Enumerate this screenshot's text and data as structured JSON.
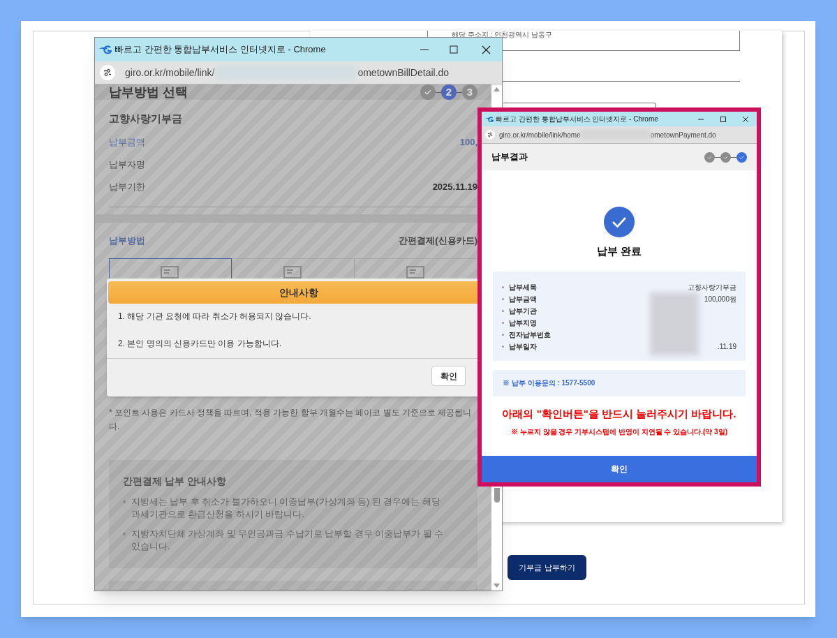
{
  "background_page": {
    "address_text": "해당 주소지 : 인천광역시 남동구",
    "donate_button": "기부금 납부하기"
  },
  "left_window": {
    "title": "빠르고 간편한 통합납부서비스 인터넷지로 - Chrome",
    "url_start": "giro.or.kr/mobile/link/",
    "url_end": "ometownBillDetail.do",
    "heading": "납부방법 선택",
    "steps": [
      {
        "kind": "done"
      },
      {
        "kind": "current",
        "label": "2"
      },
      {
        "kind": "pending",
        "label": "3"
      }
    ],
    "section_title": "고향사랑기부금",
    "rows": [
      {
        "label": "납부금액",
        "value": "100,",
        "highlight": true
      },
      {
        "label": "납부자명",
        "highlight": false
      },
      {
        "label": "납부기한",
        "value": "2025.11.19",
        "highlight": false
      }
    ],
    "method_label": "납부방법",
    "method_value": "간편결제(신용카드)",
    "method_tiles": [
      {
        "selected": true
      },
      {
        "selected": false
      },
      {
        "selected": false
      }
    ],
    "note": "* 포인트 사용은 카드사 정책을 따르며, 적용 가능한 할부 개월수는 페이코 별도 기준으로 제공됩니다.",
    "guide": {
      "title": "간편결제 납부 안내사항",
      "items": [
        "지방세는 납부 후 취소가 불가하오니 이중납부(가상계좌 등) 된 경우에는 해당 과세기관으로 환급신청을 하시기 바랍니다.",
        "지방자치단체 가상계좌 및 무인공과금 수납기로 납부할 경우 이중납부가 될 수 있습니다."
      ]
    },
    "modal": {
      "title": "안내사항",
      "lines": [
        "1. 해당 기관 요청에 따라 취소가 허용되지 않습니다.",
        "2. 본인 명의의 신용카드만 이용 가능합니다."
      ],
      "button": "확인"
    }
  },
  "right_window": {
    "title": "빠르고 간편한 통합납부서비스 인터넷지로 - Chrome",
    "url_start": "giro.or.kr/mobile/link/home",
    "url_end": "ometownPayment.do",
    "header": "납부결과",
    "steps": [
      {
        "kind": "done"
      },
      {
        "kind": "done"
      },
      {
        "kind": "current_done"
      }
    ],
    "status": "납부 완료",
    "details": [
      {
        "label": "납부세목",
        "value": "고향사랑기부금"
      },
      {
        "label": "납부금액",
        "value": "100,000원"
      },
      {
        "label": "납부기관"
      },
      {
        "label": "납부지명"
      },
      {
        "label": "전자납부번호"
      },
      {
        "label": "납부일자",
        "value": ".11.19"
      }
    ],
    "contact": "※ 납부 이용문의 : 1577-5500",
    "warning": "아래의 \"확인버튼\"을 반드시 눌러주시기 바랍니다.",
    "warning_note": "※ 누르지 않을 경우 기부시스템에 반영이 지연될 수 있습니다.(약 3일)",
    "confirm": "확인"
  }
}
